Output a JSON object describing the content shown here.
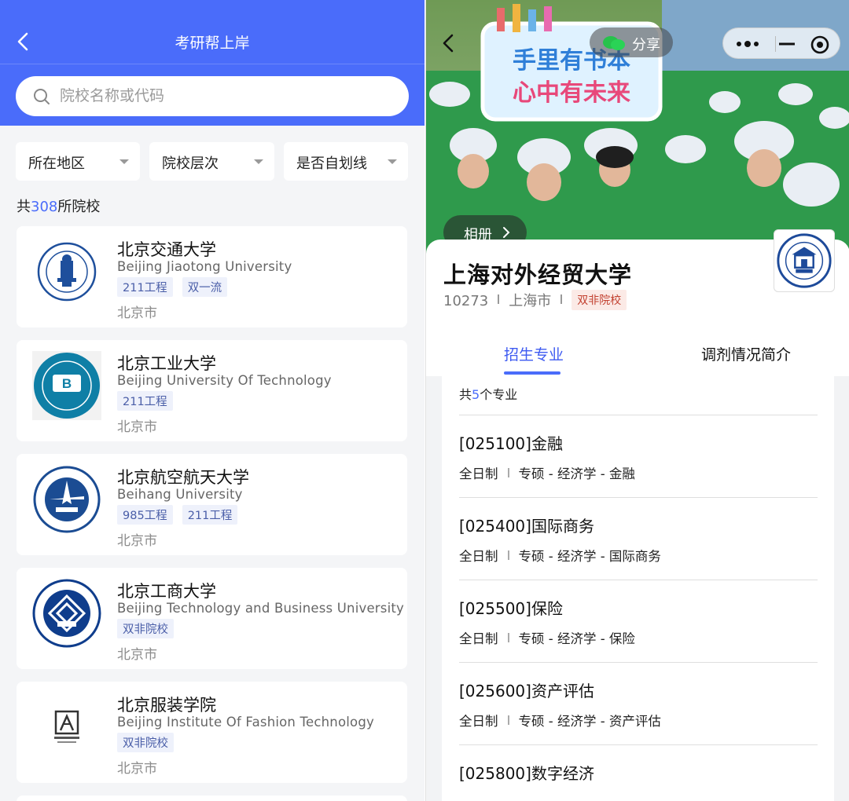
{
  "left": {
    "title": "考研帮上岸",
    "search_placeholder": "院校名称或代码",
    "filters": [
      "所在地区",
      "院校层次",
      "是否自划线"
    ],
    "count_prefix": "共",
    "count_num": "308",
    "count_suffix": "所院校",
    "schools": [
      {
        "name": "北京交通大学",
        "english": "Beijing Jiaotong University",
        "tags": [
          "211工程",
          "双一流"
        ],
        "city": "北京市"
      },
      {
        "name": "北京工业大学",
        "english": "Beijing University Of Technology",
        "tags": [
          "211工程"
        ],
        "city": "北京市"
      },
      {
        "name": "北京航空航天大学",
        "english": "Beihang University",
        "tags": [
          "985工程",
          "211工程"
        ],
        "city": "北京市"
      },
      {
        "name": "北京工商大学",
        "english": "Beijing Technology and Business University",
        "tags": [
          "双非院校"
        ],
        "city": "北京市"
      },
      {
        "name": "北京服装学院",
        "english": "Beijing Institute Of Fashion Technology",
        "tags": [
          "双非院校"
        ],
        "city": "北京市"
      }
    ]
  },
  "right": {
    "hero_sign_line1": "手里有书本",
    "hero_sign_line2": "心中有未来",
    "share_label": "分享",
    "album_label": "相册",
    "university": "上海对外经贸大学",
    "code": "10273",
    "city": "上海市",
    "badge": "双非院校",
    "tabs": [
      "招生专业",
      "调剂情况简介"
    ],
    "total_prefix": "共",
    "total_num": "5",
    "total_suffix": "个专业",
    "majors": [
      {
        "name": "[025100]金融",
        "mode": "全日制",
        "path": "专硕 - 经济学 - 金融"
      },
      {
        "name": "[025400]国际商务",
        "mode": "全日制",
        "path": "专硕 - 经济学 - 国际商务"
      },
      {
        "name": "[025500]保险",
        "mode": "全日制",
        "path": "专硕 - 经济学 - 保险"
      },
      {
        "name": "[025600]资产评估",
        "mode": "全日制",
        "path": "专硕 - 经济学 - 资产评估"
      },
      {
        "name": "[025800]数字经济",
        "mode": "",
        "path": ""
      }
    ]
  },
  "colors": {
    "brand_blue": "#4a6cfa",
    "tag_bg": "#eef1fb",
    "badge_red": "#c2402f"
  }
}
